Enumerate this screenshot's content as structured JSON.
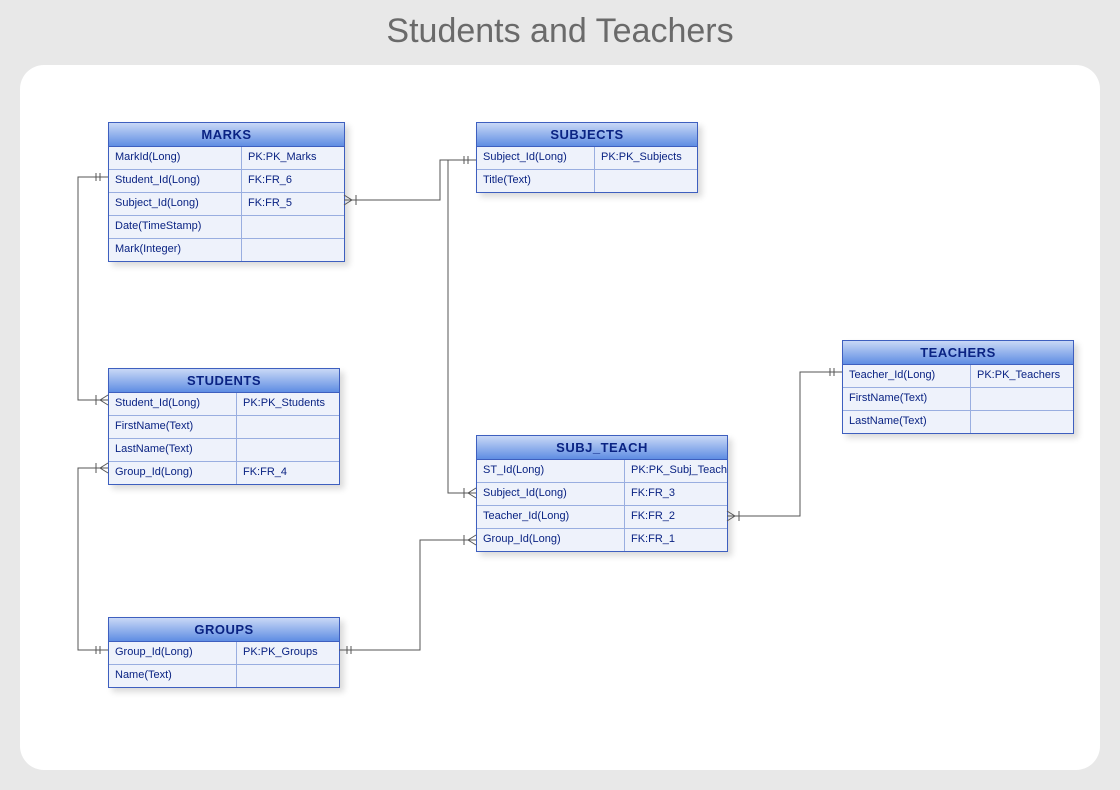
{
  "title": "Students and Teachers",
  "entities": {
    "marks": {
      "name": "MARKS",
      "rows": [
        {
          "left": "MarkId(Long)",
          "right": "PK:PK_Marks"
        },
        {
          "left": "Student_Id(Long)",
          "right": "FK:FR_6"
        },
        {
          "left": "Subject_Id(Long)",
          "right": "FK:FR_5"
        },
        {
          "left": "Date(TimeStamp)",
          "right": ""
        },
        {
          "left": "Mark(Integer)",
          "right": ""
        }
      ]
    },
    "subjects": {
      "name": "SUBJECTS",
      "rows": [
        {
          "left": "Subject_Id(Long)",
          "right": "PK:PK_Subjects"
        },
        {
          "left": "Title(Text)",
          "right": ""
        }
      ]
    },
    "teachers": {
      "name": "TEACHERS",
      "rows": [
        {
          "left": "Teacher_Id(Long)",
          "right": "PK:PK_Teachers"
        },
        {
          "left": "FirstName(Text)",
          "right": ""
        },
        {
          "left": "LastName(Text)",
          "right": ""
        }
      ]
    },
    "students": {
      "name": "STUDENTS",
      "rows": [
        {
          "left": "Student_Id(Long)",
          "right": "PK:PK_Students"
        },
        {
          "left": "FirstName(Text)",
          "right": ""
        },
        {
          "left": "LastName(Text)",
          "right": ""
        },
        {
          "left": "Group_Id(Long)",
          "right": "FK:FR_4"
        }
      ]
    },
    "subj_teach": {
      "name": "SUBJ_TEACH",
      "rows": [
        {
          "left": "ST_Id(Long)",
          "right": "PK:PK_Subj_Teach"
        },
        {
          "left": "Subject_Id(Long)",
          "right": "FK:FR_3"
        },
        {
          "left": "Teacher_Id(Long)",
          "right": "FK:FR_2"
        },
        {
          "left": "Group_Id(Long)",
          "right": "FK:FR_1"
        }
      ]
    },
    "groups": {
      "name": "GROUPS",
      "rows": [
        {
          "left": "Group_Id(Long)",
          "right": "PK:PK_Groups"
        },
        {
          "left": "Name(Text)",
          "right": ""
        }
      ]
    }
  }
}
